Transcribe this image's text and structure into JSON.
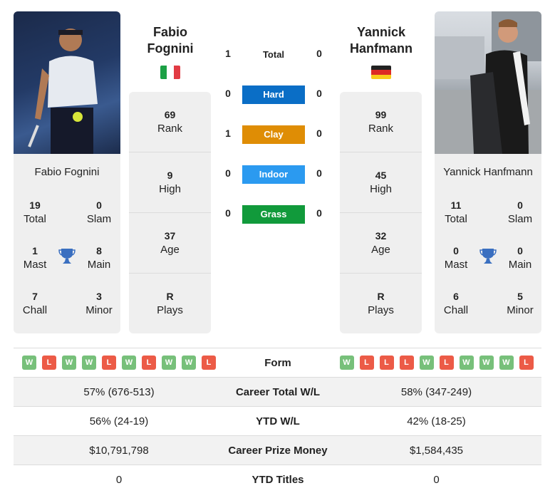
{
  "players": {
    "left": {
      "first_name": "Fabio",
      "last_name": "Fognini",
      "full_name": "Fabio Fognini",
      "flag": "italy-flag",
      "flag_colors": [
        "#1ca045",
        "#ffffff",
        "#e23b44"
      ],
      "titles": {
        "total": {
          "value": "19",
          "label": "Total"
        },
        "slam": {
          "value": "0",
          "label": "Slam"
        },
        "mast": {
          "value": "1",
          "label": "Mast"
        },
        "main": {
          "value": "8",
          "label": "Main"
        },
        "chall": {
          "value": "7",
          "label": "Chall"
        },
        "minor": {
          "value": "3",
          "label": "Minor"
        }
      },
      "stats": [
        {
          "value": "69",
          "label": "Rank"
        },
        {
          "value": "9",
          "label": "High"
        },
        {
          "value": "37",
          "label": "Age"
        },
        {
          "value": "R",
          "label": "Plays"
        }
      ],
      "form": [
        "W",
        "L",
        "W",
        "W",
        "L",
        "W",
        "L",
        "W",
        "W",
        "L"
      ],
      "career_total_wl": "57% (676-513)",
      "ytd_wl": "56% (24-19)",
      "career_prize_money": "$10,791,798",
      "ytd_titles": "0"
    },
    "right": {
      "first_name": "Yannick",
      "last_name": "Hanfmann",
      "full_name": "Yannick Hanfmann",
      "flag": "germany-flag",
      "flag_colors": [
        "#222222",
        "#dd2b24",
        "#f8cc1b"
      ],
      "titles": {
        "total": {
          "value": "11",
          "label": "Total"
        },
        "slam": {
          "value": "0",
          "label": "Slam"
        },
        "mast": {
          "value": "0",
          "label": "Mast"
        },
        "main": {
          "value": "0",
          "label": "Main"
        },
        "chall": {
          "value": "6",
          "label": "Chall"
        },
        "minor": {
          "value": "5",
          "label": "Minor"
        }
      },
      "stats": [
        {
          "value": "99",
          "label": "Rank"
        },
        {
          "value": "45",
          "label": "High"
        },
        {
          "value": "32",
          "label": "Age"
        },
        {
          "value": "R",
          "label": "Plays"
        }
      ],
      "form": [
        "W",
        "L",
        "L",
        "L",
        "W",
        "L",
        "W",
        "W",
        "W",
        "L"
      ],
      "career_total_wl": "58% (347-249)",
      "ytd_wl": "42% (18-25)",
      "career_prize_money": "$1,584,435",
      "ytd_titles": "0"
    }
  },
  "h2h": [
    {
      "label": "Total",
      "left": "1",
      "right": "0",
      "color": ""
    },
    {
      "label": "Hard",
      "left": "0",
      "right": "0",
      "color": "#0a6ec6"
    },
    {
      "label": "Clay",
      "left": "1",
      "right": "0",
      "color": "#df8d05"
    },
    {
      "label": "Indoor",
      "left": "0",
      "right": "0",
      "color": "#2b9af0"
    },
    {
      "label": "Grass",
      "left": "0",
      "right": "0",
      "color": "#119a3b"
    }
  ],
  "table_labels": {
    "form": "Form",
    "career_total_wl": "Career Total W/L",
    "ytd_wl": "YTD W/L",
    "career_prize_money": "Career Prize Money",
    "ytd_titles": "YTD Titles"
  },
  "icons": {
    "trophy": "trophy-icon"
  },
  "colors": {
    "trophy": "#3a6fc0",
    "win": "#77c07a",
    "loss": "#ec5b47",
    "card_bg": "#efefef"
  }
}
